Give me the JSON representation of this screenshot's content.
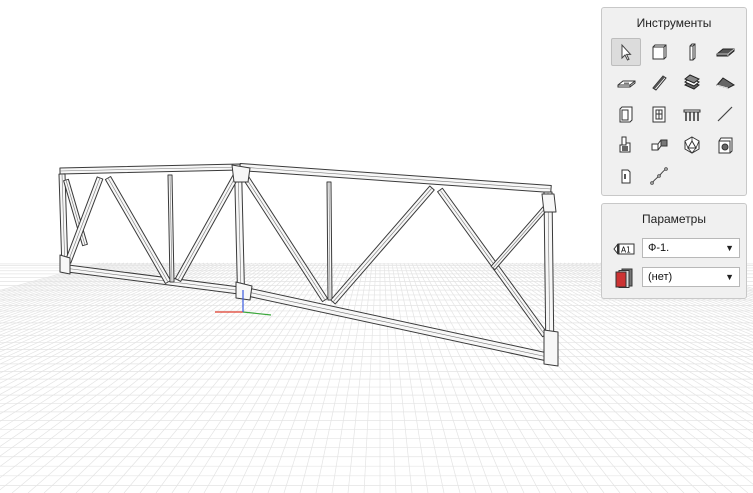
{
  "tools_panel": {
    "title": "Инструменты",
    "tools": [
      {
        "name": "select-tool-icon"
      },
      {
        "name": "solid-box-icon"
      },
      {
        "name": "column-icon"
      },
      {
        "name": "slab-icon"
      },
      {
        "name": "plate-icon"
      },
      {
        "name": "beam-icon"
      },
      {
        "name": "stair-icon"
      },
      {
        "name": "roof-icon"
      },
      {
        "name": "opening-icon"
      },
      {
        "name": "door-icon"
      },
      {
        "name": "railing-icon"
      },
      {
        "name": "line-icon"
      },
      {
        "name": "connection-icon"
      },
      {
        "name": "duct-icon"
      },
      {
        "name": "polyhedron-icon"
      },
      {
        "name": "element-copy-icon"
      },
      {
        "name": "profile-icon"
      },
      {
        "name": "curve-icon"
      }
    ]
  },
  "params_panel": {
    "title": "Параметры",
    "mark_icon_text": "A1",
    "mark_value": "Ф-1.",
    "material_value": "(нет)"
  },
  "colors": {
    "panel_bg": "#f0f0f0",
    "grid_line": "#e6e6e6",
    "axis_x": "#e03c2c",
    "axis_y": "#3aa63a",
    "axis_z": "#3a5adf"
  }
}
